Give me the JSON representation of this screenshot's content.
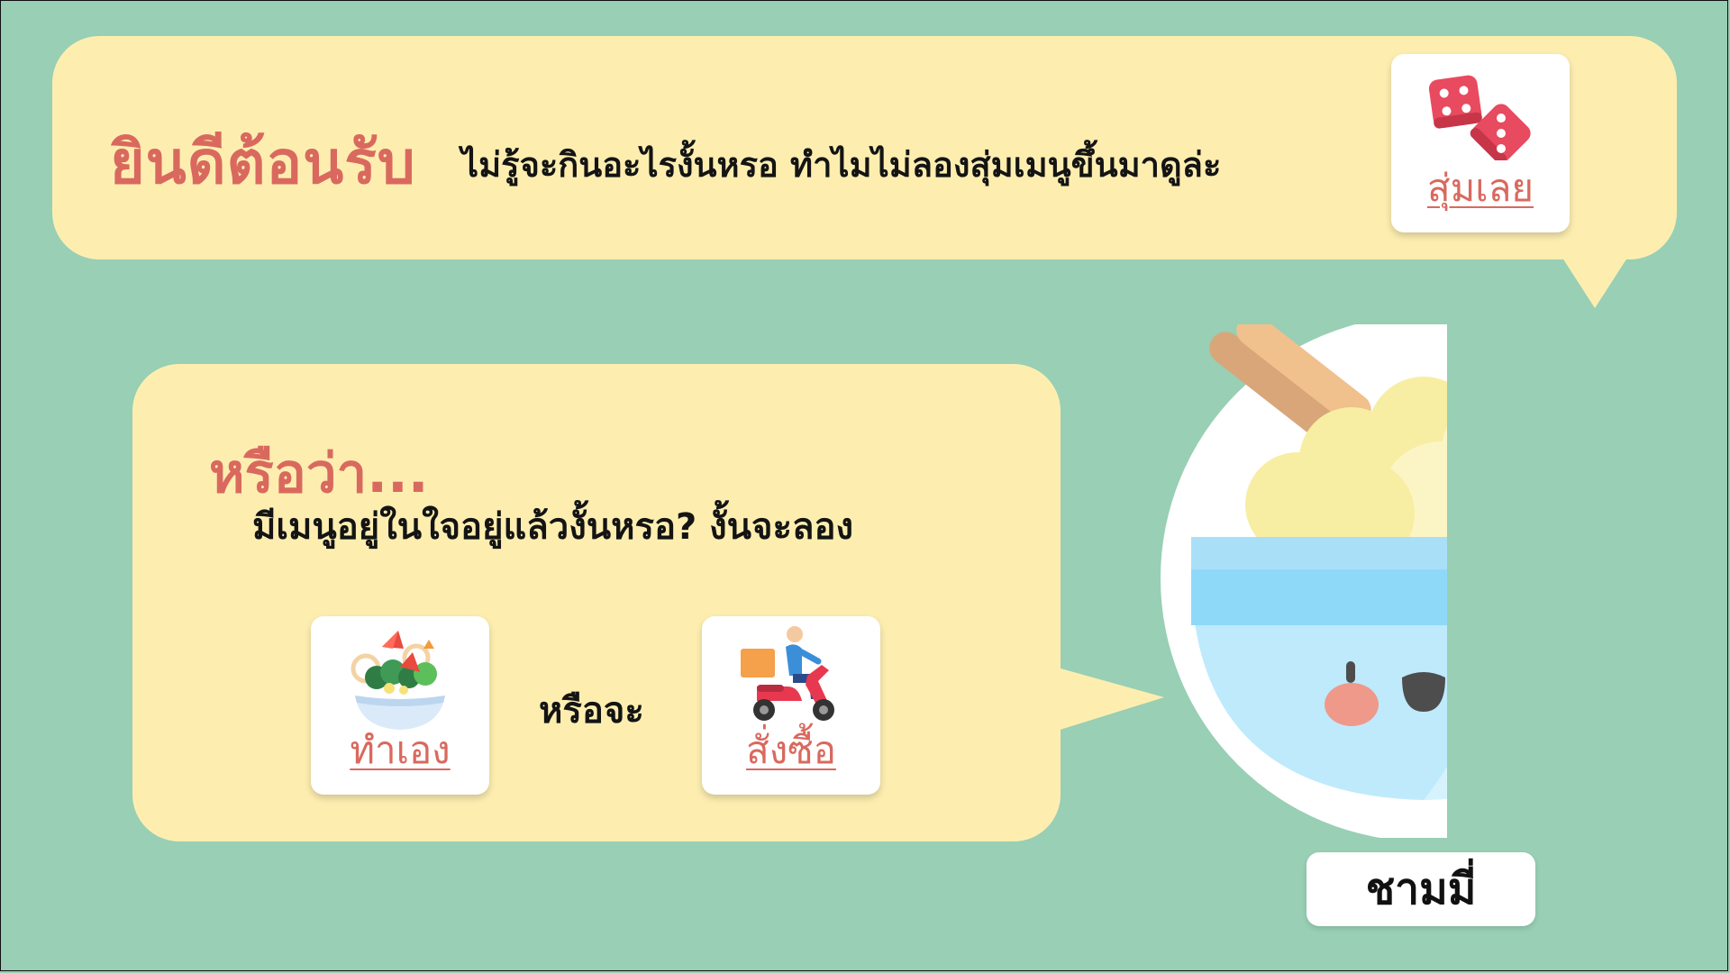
{
  "header": {
    "welcome_title": "ยินดีต้อนรับ",
    "intro_text": "ไม่รู้จะกินอะไรงั้นหรอ ทำไมไม่ลองสุ่มเมนูขึ้นมาดูล่ะ"
  },
  "random_button": {
    "label": "สุ่มเลย",
    "icon": "dice-icon"
  },
  "alternative": {
    "heading": "หรือว่า...",
    "question": "มีเมนูอยู่ในใจอยู่แล้วงั้นหรอ? งั้นจะลอง",
    "connector": "หรือจะ",
    "cook_button": {
      "label": "ทำเอง",
      "icon": "salad-bowl-icon"
    },
    "order_button": {
      "label": "สั่งซื้อ",
      "icon": "delivery-scooter-icon"
    }
  },
  "mascot": {
    "name": "ชามมี่",
    "icon": "rice-bowl-mascot-icon"
  },
  "colors": {
    "background": "#98cfb5",
    "bubble": "#fdeeb0",
    "accent": "#d9695e",
    "text": "#141414"
  }
}
